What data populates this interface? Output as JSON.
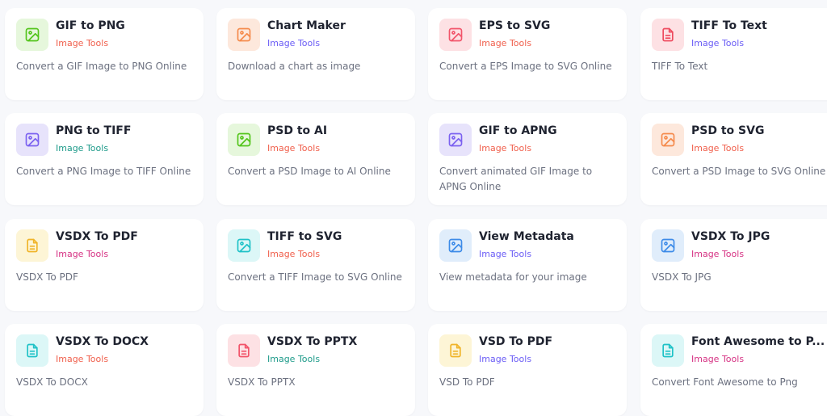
{
  "cards": [
    {
      "title": "GIF to PNG",
      "category": "Image Tools",
      "description": "Convert a GIF Image to PNG Online",
      "icon": "image-icon",
      "icon_bg": "#e6f7dc",
      "icon_color": "#52c41a",
      "category_color": "#f0604d"
    },
    {
      "title": "Chart Maker",
      "category": "Image Tools",
      "description": "Download a chart as image",
      "icon": "image-icon",
      "icon_bg": "#fde8dc",
      "icon_color": "#f58a4b",
      "category_color": "#6a5cf5"
    },
    {
      "title": "EPS to SVG",
      "category": "Image Tools",
      "description": "Convert a EPS Image to SVG Online",
      "icon": "image-icon",
      "icon_bg": "#fde1e4",
      "icon_color": "#f2546a",
      "category_color": "#f0604d"
    },
    {
      "title": "TIFF To Text",
      "category": "Image Tools",
      "description": "TIFF To Text",
      "icon": "document-icon",
      "icon_bg": "#fde1e4",
      "icon_color": "#ee4a5e",
      "category_color": "#6a5cf5"
    },
    {
      "title": "PNG to TIFF",
      "category": "Image Tools",
      "description": "Convert a PNG Image to TIFF Online",
      "icon": "image-icon",
      "icon_bg": "#e7e3fb",
      "icon_color": "#7b61f0",
      "category_color": "#1e9b8a"
    },
    {
      "title": "PSD to AI",
      "category": "Image Tools",
      "description": "Convert a PSD Image to AI Online",
      "icon": "image-icon",
      "icon_bg": "#e6f7dc",
      "icon_color": "#52c41a",
      "category_color": "#f0604d"
    },
    {
      "title": "GIF to APNG",
      "category": "Image Tools",
      "description": "Convert animated GIF Image to APNG Online",
      "icon": "image-icon",
      "icon_bg": "#e7e3fb",
      "icon_color": "#7b61f0",
      "category_color": "#f0604d"
    },
    {
      "title": "PSD to SVG",
      "category": "Image Tools",
      "description": "Convert a PSD Image to SVG Online",
      "icon": "image-icon",
      "icon_bg": "#fde8dc",
      "icon_color": "#f58a4b",
      "category_color": "#f0604d"
    },
    {
      "title": "VSDX To PDF",
      "category": "Image Tools",
      "description": "VSDX To PDF",
      "icon": "document-icon",
      "icon_bg": "#fdf5d6",
      "icon_color": "#f0b429",
      "category_color": "#d63384"
    },
    {
      "title": "TIFF to SVG",
      "category": "Image Tools",
      "description": "Convert a TIFF Image to SVG Online",
      "icon": "image-icon",
      "icon_bg": "#dcf7f7",
      "icon_color": "#1fc2c7",
      "category_color": "#f0604d"
    },
    {
      "title": "View Metadata",
      "category": "Image Tools",
      "description": "View metadata for your image",
      "icon": "image-icon",
      "icon_bg": "#e0edfb",
      "icon_color": "#3d8be8",
      "category_color": "#6a5cf5"
    },
    {
      "title": "VSDX To JPG",
      "category": "Image Tools",
      "description": "VSDX To JPG",
      "icon": "image-icon",
      "icon_bg": "#e0edfb",
      "icon_color": "#3d8be8",
      "category_color": "#d63384"
    },
    {
      "title": "VSDX To DOCX",
      "category": "Image Tools",
      "description": "VSDX To DOCX",
      "icon": "document-icon",
      "icon_bg": "#dcf7f7",
      "icon_color": "#1fc2c7",
      "category_color": "#f0604d"
    },
    {
      "title": "VSDX To PPTX",
      "category": "Image Tools",
      "description": "VSDX To PPTX",
      "icon": "document-icon",
      "icon_bg": "#fde1e4",
      "icon_color": "#f2546a",
      "category_color": "#1e9b8a"
    },
    {
      "title": "VSD To PDF",
      "category": "Image Tools",
      "description": "VSD To PDF",
      "icon": "document-icon",
      "icon_bg": "#fdf5d6",
      "icon_color": "#f0b429",
      "category_color": "#6a5cf5"
    },
    {
      "title": "Font Awesome to P...",
      "category": "Image Tools",
      "description": "Convert Font Awesome to Png",
      "icon": "document-icon",
      "icon_bg": "#dcf7f7",
      "icon_color": "#1fc2c7",
      "category_color": "#d63384"
    }
  ]
}
